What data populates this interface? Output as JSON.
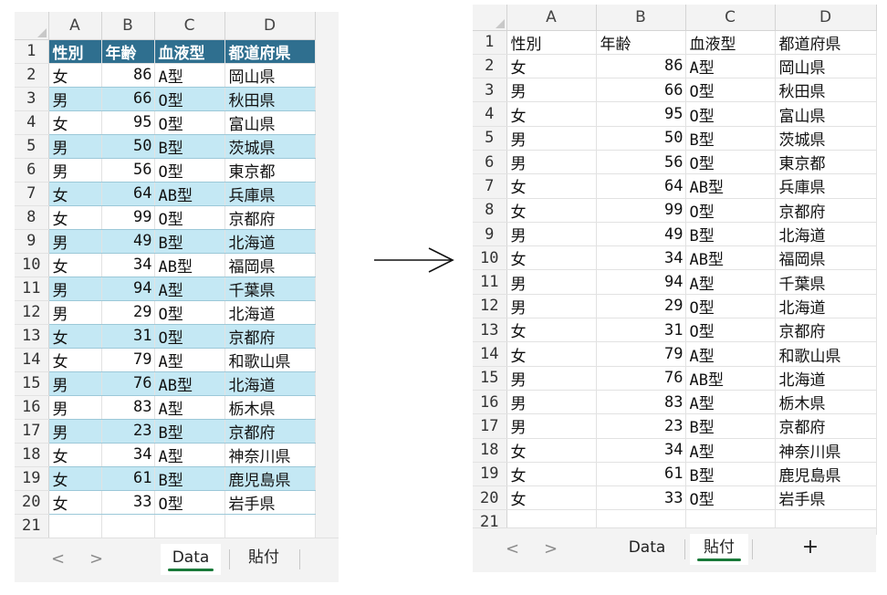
{
  "columns": [
    "A",
    "B",
    "C",
    "D"
  ],
  "header": [
    "性別",
    "年齢",
    "血液型",
    "都道府県"
  ],
  "rows": [
    [
      "女",
      "86",
      "A型",
      "岡山県"
    ],
    [
      "男",
      "66",
      "O型",
      "秋田県"
    ],
    [
      "女",
      "95",
      "O型",
      "富山県"
    ],
    [
      "男",
      "50",
      "B型",
      "茨城県"
    ],
    [
      "男",
      "56",
      "O型",
      "東京都"
    ],
    [
      "女",
      "64",
      "AB型",
      "兵庫県"
    ],
    [
      "女",
      "99",
      "O型",
      "京都府"
    ],
    [
      "男",
      "49",
      "B型",
      "北海道"
    ],
    [
      "女",
      "34",
      "AB型",
      "福岡県"
    ],
    [
      "男",
      "94",
      "A型",
      "千葉県"
    ],
    [
      "男",
      "29",
      "O型",
      "北海道"
    ],
    [
      "女",
      "31",
      "O型",
      "京都府"
    ],
    [
      "女",
      "79",
      "A型",
      "和歌山県"
    ],
    [
      "男",
      "76",
      "AB型",
      "北海道"
    ],
    [
      "男",
      "83",
      "A型",
      "栃木県"
    ],
    [
      "男",
      "23",
      "B型",
      "京都府"
    ],
    [
      "女",
      "34",
      "A型",
      "神奈川県"
    ],
    [
      "女",
      "61",
      "B型",
      "鹿児島県"
    ],
    [
      "女",
      "33",
      "O型",
      "岩手県"
    ]
  ],
  "last_row_number": "21",
  "left_tabs": [
    "Data",
    "貼付"
  ],
  "left_active_tab": "Data",
  "right_tabs": [
    "Data",
    "貼付"
  ],
  "right_active_tab": "貼付",
  "add_sheet_label": "+",
  "nav_prev": "<",
  "nav_next": ">",
  "colors": {
    "header_fill": "#2f6f8f",
    "band_fill": "#c4e8f4",
    "active_tab_underline": "#1a7a3a"
  }
}
